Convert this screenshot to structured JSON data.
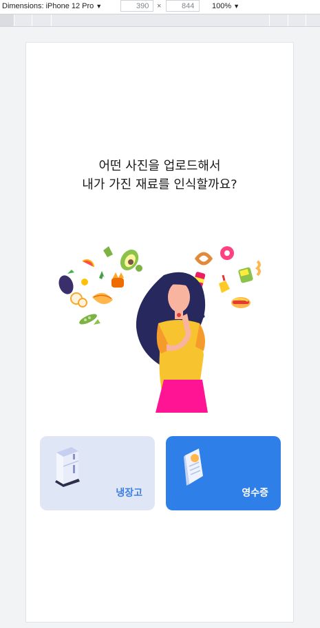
{
  "devtools": {
    "device_label": "Dimensions: iPhone 12 Pro",
    "width_value": "390",
    "height_value": "844",
    "times_symbol": "×",
    "zoom_label": "100%"
  },
  "page": {
    "question_line1": "어떤 사진을 업로드해서",
    "question_line2": "내가 가진 재료를 인식할까요?"
  },
  "options": [
    {
      "label": "냉장고",
      "icon": "refrigerator-icon"
    },
    {
      "label": "영수증",
      "icon": "receipt-icon"
    }
  ],
  "colors": {
    "fridge_card_bg": "#dfe6f5",
    "fridge_label": "#3c7fe0",
    "receipt_card_bg": "#2f7fe8",
    "receipt_label": "#ffffff"
  }
}
